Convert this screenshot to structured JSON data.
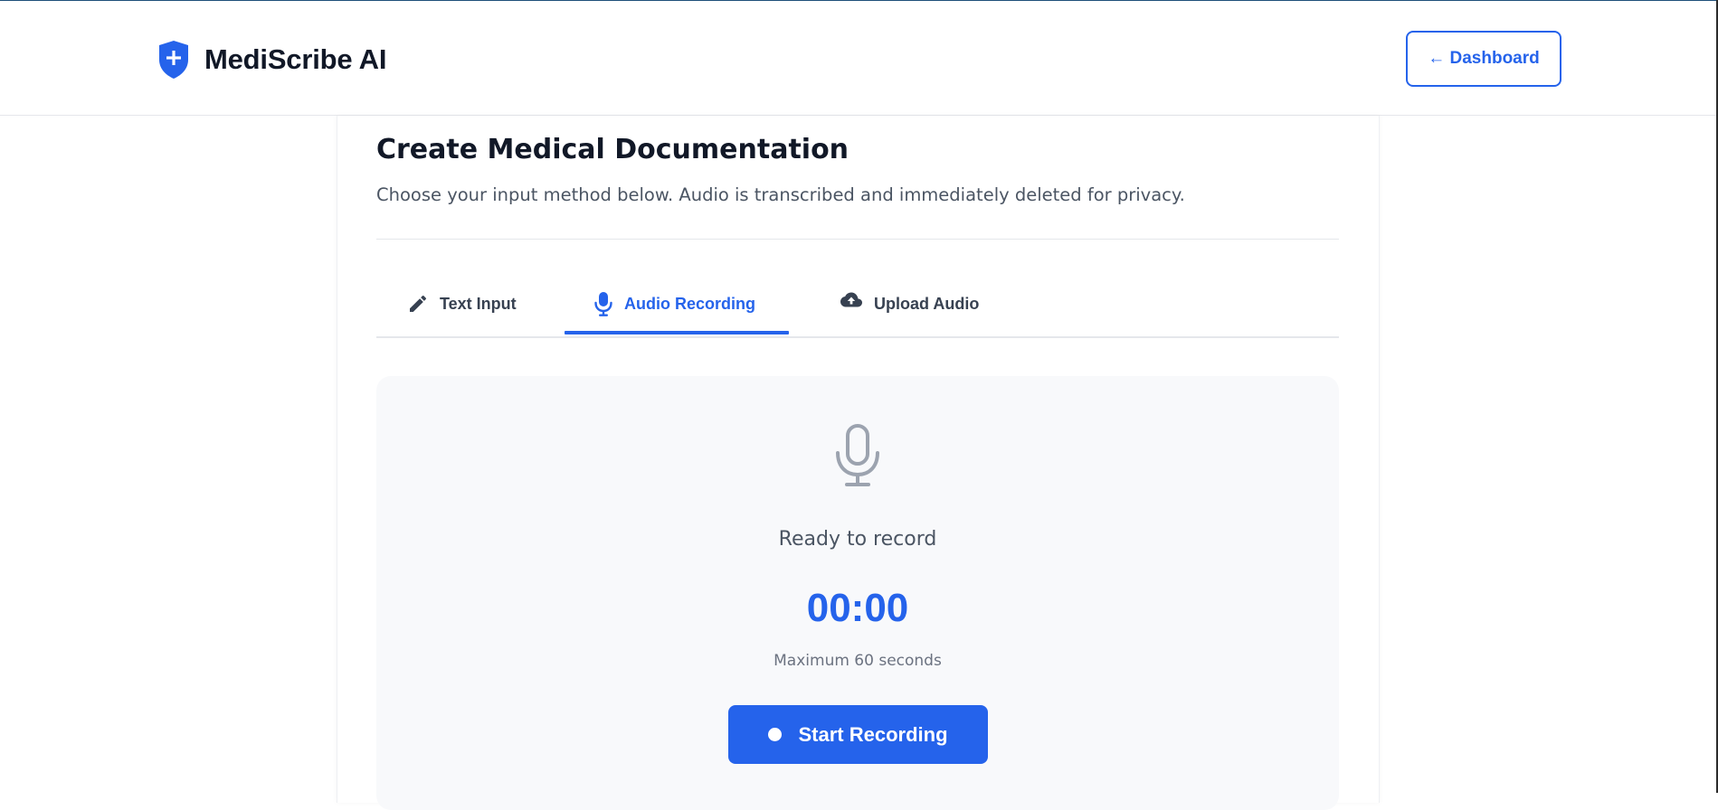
{
  "app": {
    "name": "MediScribe AI",
    "logo_icon": "shield-plus-icon",
    "accent_color": "#2563eb"
  },
  "header": {
    "dashboard_button": "← Dashboard"
  },
  "page": {
    "title": "Create Medical Documentation",
    "subtitle": "Choose your input method below. Audio is transcribed and immediately deleted for privacy."
  },
  "tabs": [
    {
      "label": "Text Input",
      "icon": "pencil-icon",
      "active": false
    },
    {
      "label": "Audio Recording",
      "icon": "microphone-icon",
      "active": true
    },
    {
      "label": "Upload Audio",
      "icon": "cloud-upload-icon",
      "active": false
    }
  ],
  "recorder": {
    "icon": "microphone-icon",
    "status": "Ready to record",
    "timer": "00:00",
    "max_note": "Maximum 60 seconds",
    "start_button": "Start Recording"
  }
}
